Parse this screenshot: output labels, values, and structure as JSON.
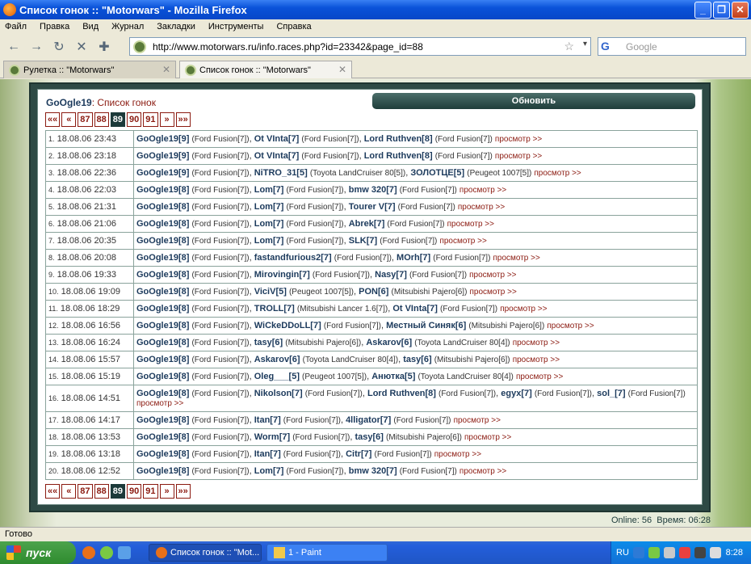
{
  "window": {
    "title": "Список гонок :: \"Motorwars\" - Mozilla Firefox"
  },
  "menu": [
    "Файл",
    "Правка",
    "Вид",
    "Журнал",
    "Закладки",
    "Инструменты",
    "Справка"
  ],
  "nav": {
    "url": "http://www.motorwars.ru/info.races.php?id=23342&page_id=88",
    "search_placeholder": "Google"
  },
  "tabs": [
    {
      "label": "Рулетка :: \"Motorwars\"",
      "active": false
    },
    {
      "label": "Список гонок :: \"Motorwars\"",
      "active": true
    }
  ],
  "page": {
    "user": "GoOgle19",
    "subtitle": ": Список гонок",
    "refresh_label": "Обновить",
    "pager": [
      "««",
      "«",
      "87",
      "88",
      "89",
      "90",
      "91",
      "»",
      "»»"
    ],
    "pager_current": "89",
    "view_label": "просмотр >>",
    "online": "Online: 56",
    "time": "Время: 06:28"
  },
  "races": [
    {
      "n": "1.",
      "date": "18.08.06 23:43",
      "participants": [
        {
          "d": "GoOgle19[9]",
          "c": "(Ford Fusion[7])"
        },
        {
          "d": "Ot VInta[7]",
          "c": "(Ford Fusion[7])"
        },
        {
          "d": "Lord Ruthven[8]",
          "c": "(Ford Fusion[7])"
        }
      ]
    },
    {
      "n": "2.",
      "date": "18.08.06 23:18",
      "participants": [
        {
          "d": "GoOgle19[9]",
          "c": "(Ford Fusion[7])"
        },
        {
          "d": "Ot VInta[7]",
          "c": "(Ford Fusion[7])"
        },
        {
          "d": "Lord Ruthven[8]",
          "c": "(Ford Fusion[7])"
        }
      ]
    },
    {
      "n": "3.",
      "date": "18.08.06 22:36",
      "participants": [
        {
          "d": "GoOgle19[9]",
          "c": "(Ford Fusion[7])"
        },
        {
          "d": "NiTRO_31[5]",
          "c": "(Toyota LandCruiser 80[5])"
        },
        {
          "d": "ЗОЛОТЦЕ[5]",
          "c": "(Peugeot 1007[5])"
        }
      ]
    },
    {
      "n": "4.",
      "date": "18.08.06 22:03",
      "participants": [
        {
          "d": "GoOgle19[8]",
          "c": "(Ford Fusion[7])"
        },
        {
          "d": "Lom[7]",
          "c": "(Ford Fusion[7])"
        },
        {
          "d": "bmw 320[7]",
          "c": "(Ford Fusion[7])"
        }
      ]
    },
    {
      "n": "5.",
      "date": "18.08.06 21:31",
      "participants": [
        {
          "d": "GoOgle19[8]",
          "c": "(Ford Fusion[7])"
        },
        {
          "d": "Lom[7]",
          "c": "(Ford Fusion[7])"
        },
        {
          "d": "Tourer V[7]",
          "c": "(Ford Fusion[7])"
        }
      ]
    },
    {
      "n": "6.",
      "date": "18.08.06 21:06",
      "participants": [
        {
          "d": "GoOgle19[8]",
          "c": "(Ford Fusion[7])"
        },
        {
          "d": "Lom[7]",
          "c": "(Ford Fusion[7])"
        },
        {
          "d": "Abrek[7]",
          "c": "(Ford Fusion[7])"
        }
      ]
    },
    {
      "n": "7.",
      "date": "18.08.06 20:35",
      "participants": [
        {
          "d": "GoOgle19[8]",
          "c": "(Ford Fusion[7])"
        },
        {
          "d": "Lom[7]",
          "c": "(Ford Fusion[7])"
        },
        {
          "d": "SLK[7]",
          "c": "(Ford Fusion[7])"
        }
      ]
    },
    {
      "n": "8.",
      "date": "18.08.06 20:08",
      "participants": [
        {
          "d": "GoOgle19[8]",
          "c": "(Ford Fusion[7])"
        },
        {
          "d": "fastandfurious2[7]",
          "c": "(Ford Fusion[7])"
        },
        {
          "d": "MOrh[7]",
          "c": "(Ford Fusion[7])"
        }
      ]
    },
    {
      "n": "9.",
      "date": "18.08.06 19:33",
      "participants": [
        {
          "d": "GoOgle19[8]",
          "c": "(Ford Fusion[7])"
        },
        {
          "d": "Mirovingin[7]",
          "c": "(Ford Fusion[7])"
        },
        {
          "d": "Nasy[7]",
          "c": "(Ford Fusion[7])"
        }
      ]
    },
    {
      "n": "10.",
      "date": "18.08.06 19:09",
      "participants": [
        {
          "d": "GoOgle19[8]",
          "c": "(Ford Fusion[7])"
        },
        {
          "d": "ViciV[5]",
          "c": "(Peugeot 1007[5])"
        },
        {
          "d": "PON[6]",
          "c": "(Mitsubishi Pajero[6])"
        }
      ]
    },
    {
      "n": "11.",
      "date": "18.08.06 18:29",
      "participants": [
        {
          "d": "GoOgle19[8]",
          "c": "(Ford Fusion[7])"
        },
        {
          "d": "TROLL[7]",
          "c": "(Mitsubishi Lancer 1.6[7])"
        },
        {
          "d": "Ot VInta[7]",
          "c": "(Ford Fusion[7])"
        }
      ]
    },
    {
      "n": "12.",
      "date": "18.08.06 16:56",
      "participants": [
        {
          "d": "GoOgle19[8]",
          "c": "(Ford Fusion[7])"
        },
        {
          "d": "WiCkeDDoLL[7]",
          "c": "(Ford Fusion[7])"
        },
        {
          "d": "Местный Синяк[6]",
          "c": "(Mitsubishi Pajero[6])"
        }
      ]
    },
    {
      "n": "13.",
      "date": "18.08.06 16:24",
      "participants": [
        {
          "d": "GoOgle19[8]",
          "c": "(Ford Fusion[7])"
        },
        {
          "d": "tasy[6]",
          "c": "(Mitsubishi Pajero[6])"
        },
        {
          "d": "Askarov[6]",
          "c": "(Toyota LandCruiser 80[4])"
        }
      ]
    },
    {
      "n": "14.",
      "date": "18.08.06 15:57",
      "participants": [
        {
          "d": "GoOgle19[8]",
          "c": "(Ford Fusion[7])"
        },
        {
          "d": "Askarov[6]",
          "c": "(Toyota LandCruiser 80[4])"
        },
        {
          "d": "tasy[6]",
          "c": "(Mitsubishi Pajero[6])"
        }
      ]
    },
    {
      "n": "15.",
      "date": "18.08.06 15:19",
      "participants": [
        {
          "d": "GoOgle19[8]",
          "c": "(Ford Fusion[7])"
        },
        {
          "d": "Oleg___[5]",
          "c": "(Peugeot 1007[5])"
        },
        {
          "d": "Анютка[5]",
          "c": "(Toyota LandCruiser 80[4])"
        }
      ]
    },
    {
      "n": "16.",
      "date": "18.08.06 14:51",
      "tall": true,
      "participants": [
        {
          "d": "GoOgle19[8]",
          "c": "(Ford Fusion[7])"
        },
        {
          "d": "Nikolson[7]",
          "c": "(Ford Fusion[7])"
        },
        {
          "d": "Lord Ruthven[8]",
          "c": "(Ford Fusion[7])"
        },
        {
          "d": "egyx[7]",
          "c": "(Ford Fusion[7])"
        },
        {
          "d": "sol_[7]",
          "c": "(Ford Fusion[7])"
        }
      ]
    },
    {
      "n": "17.",
      "date": "18.08.06 14:17",
      "participants": [
        {
          "d": "GoOgle19[8]",
          "c": "(Ford Fusion[7])"
        },
        {
          "d": "Itan[7]",
          "c": "(Ford Fusion[7])"
        },
        {
          "d": "4lligator[7]",
          "c": "(Ford Fusion[7])"
        }
      ]
    },
    {
      "n": "18.",
      "date": "18.08.06 13:53",
      "participants": [
        {
          "d": "GoOgle19[8]",
          "c": "(Ford Fusion[7])"
        },
        {
          "d": "Worm[7]",
          "c": "(Ford Fusion[7])"
        },
        {
          "d": "tasy[6]",
          "c": "(Mitsubishi Pajero[6])"
        }
      ]
    },
    {
      "n": "19.",
      "date": "18.08.06 13:18",
      "participants": [
        {
          "d": "GoOgle19[8]",
          "c": "(Ford Fusion[7])"
        },
        {
          "d": "Itan[7]",
          "c": "(Ford Fusion[7])"
        },
        {
          "d": "Citr[7]",
          "c": "(Ford Fusion[7])"
        }
      ]
    },
    {
      "n": "20.",
      "date": "18.08.06 12:52",
      "participants": [
        {
          "d": "GoOgle19[8]",
          "c": "(Ford Fusion[7])"
        },
        {
          "d": "Lom[7]",
          "c": "(Ford Fusion[7])"
        },
        {
          "d": "bmw 320[7]",
          "c": "(Ford Fusion[7])"
        }
      ]
    }
  ],
  "status": "Готово",
  "taskbar": {
    "start": "пуск",
    "items": [
      "Список гонок :: \"Mot...",
      "1 - Paint"
    ],
    "lang": "RU",
    "clock": "8:28"
  },
  "colors": {
    "accent": "#8b1a10",
    "driver": "#1c3a5c",
    "frame": "#2e4a45"
  }
}
